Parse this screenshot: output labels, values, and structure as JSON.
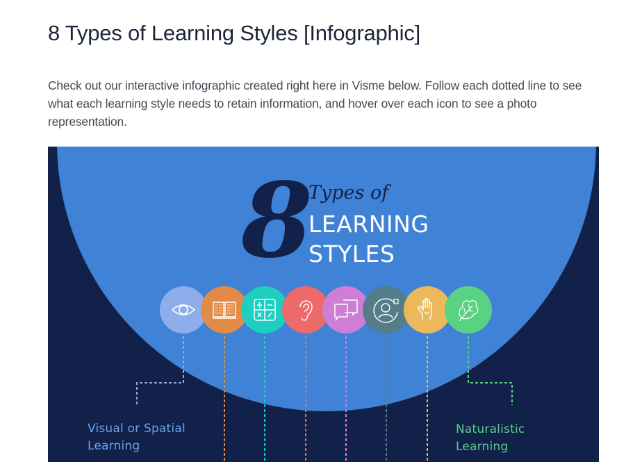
{
  "article": {
    "title": "8 Types of Learning Styles [Infographic]",
    "intro": "Check out our interactive infographic created right here in Visme below. Follow each dotted line to see what each learning style needs to retain information, and hover over each icon to see a photo representation."
  },
  "infographic": {
    "numeral": "8",
    "types_of": "Types of",
    "heading_line1": "LEARNING",
    "heading_line2": "STYLES",
    "colors": {
      "background": "#12214a",
      "circle": "#3f82d6",
      "dark_text": "#12214a",
      "white_text": "#ffffff"
    },
    "styles": [
      {
        "icon": "eye-icon",
        "color": "#8fadea"
      },
      {
        "icon": "open-book-icon",
        "color": "#e28a48"
      },
      {
        "icon": "calculator-icon",
        "color": "#1ccfc0"
      },
      {
        "icon": "ear-icon",
        "color": "#ec6a6a"
      },
      {
        "icon": "speech-bubbles-icon",
        "color": "#cf7ed6"
      },
      {
        "icon": "person-thought-icon",
        "color": "#557d88"
      },
      {
        "icon": "raised-hand-icon",
        "color": "#ebb95a"
      },
      {
        "icon": "leaf-icon",
        "color": "#5ad283"
      }
    ],
    "labels": {
      "left_line1": "Visual or Spatial",
      "left_line2": "Learning",
      "right_line1": "Naturalistic",
      "right_line2": "Learning"
    }
  }
}
